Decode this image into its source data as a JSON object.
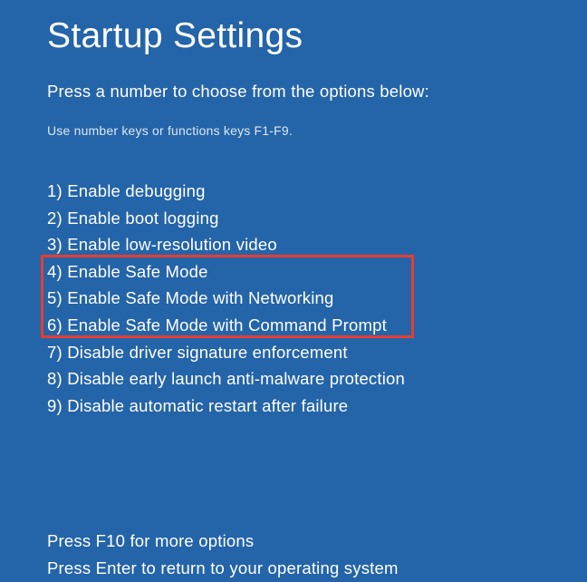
{
  "title": "Startup Settings",
  "subtitle": "Press a number to choose from the options below:",
  "hint": "Use number keys or functions keys F1-F9.",
  "options": [
    {
      "num": "1",
      "label": "Enable debugging"
    },
    {
      "num": "2",
      "label": "Enable boot logging"
    },
    {
      "num": "3",
      "label": "Enable low-resolution video"
    },
    {
      "num": "4",
      "label": "Enable Safe Mode"
    },
    {
      "num": "5",
      "label": "Enable Safe Mode with Networking"
    },
    {
      "num": "6",
      "label": "Enable Safe Mode with Command Prompt"
    },
    {
      "num": "7",
      "label": "Disable driver signature enforcement"
    },
    {
      "num": "8",
      "label": "Disable early launch anti-malware protection"
    },
    {
      "num": "9",
      "label": "Disable automatic restart after failure"
    }
  ],
  "footer": {
    "line1": "Press F10 for more options",
    "line2": "Press Enter to return to your operating system"
  }
}
